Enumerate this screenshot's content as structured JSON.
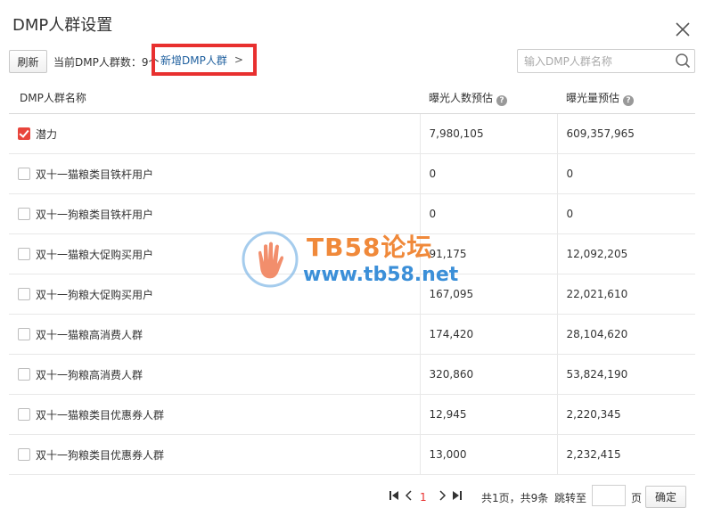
{
  "dialog": {
    "title": "DMP人群设置"
  },
  "toolbar": {
    "refresh_label": "刷新",
    "group_count_text": "当前DMP人群数：9个",
    "add_group_label": "新增DMP人群",
    "add_group_chevron": ">",
    "search_placeholder": "输入DMP人群名称"
  },
  "table": {
    "headers": {
      "name": "DMP人群名称",
      "exposure_people": "曝光人数预估",
      "exposure_volume": "曝光量预估"
    },
    "help_glyph": "?",
    "rows": [
      {
        "name": "潜力",
        "checked": true,
        "people": "7,980,105",
        "volume": "609,357,965"
      },
      {
        "name": "双十一猫粮类目铁杆用户",
        "checked": false,
        "people": "0",
        "volume": "0"
      },
      {
        "name": "双十一狗粮类目铁杆用户",
        "checked": false,
        "people": "0",
        "volume": "0"
      },
      {
        "name": "双十一猫粮大促购买用户",
        "checked": false,
        "people": "91,175",
        "volume": "12,092,205"
      },
      {
        "name": "双十一狗粮大促购买用户",
        "checked": false,
        "people": "167,095",
        "volume": "22,021,610"
      },
      {
        "name": "双十一猫粮高消费人群",
        "checked": false,
        "people": "174,420",
        "volume": "28,104,620"
      },
      {
        "name": "双十一狗粮高消费人群",
        "checked": false,
        "people": "320,860",
        "volume": "53,824,190"
      },
      {
        "name": "双十一猫粮类目优惠券人群",
        "checked": false,
        "people": "12,945",
        "volume": "2,220,345"
      },
      {
        "name": "双十一狗粮类目优惠券人群",
        "checked": false,
        "people": "13,000",
        "volume": "2,232,415"
      }
    ]
  },
  "watermark": {
    "line1": "TB58论坛",
    "line2": "www.tb58.net"
  },
  "pagination": {
    "current_page": "1",
    "summary": "共1页，共9条",
    "jump_label": "跳转至",
    "page_unit": "页",
    "confirm_label": "确定"
  },
  "colors": {
    "accent_red": "#e8302f",
    "link_blue": "#1e5f9e",
    "checkbox_red": "#e8453c"
  }
}
